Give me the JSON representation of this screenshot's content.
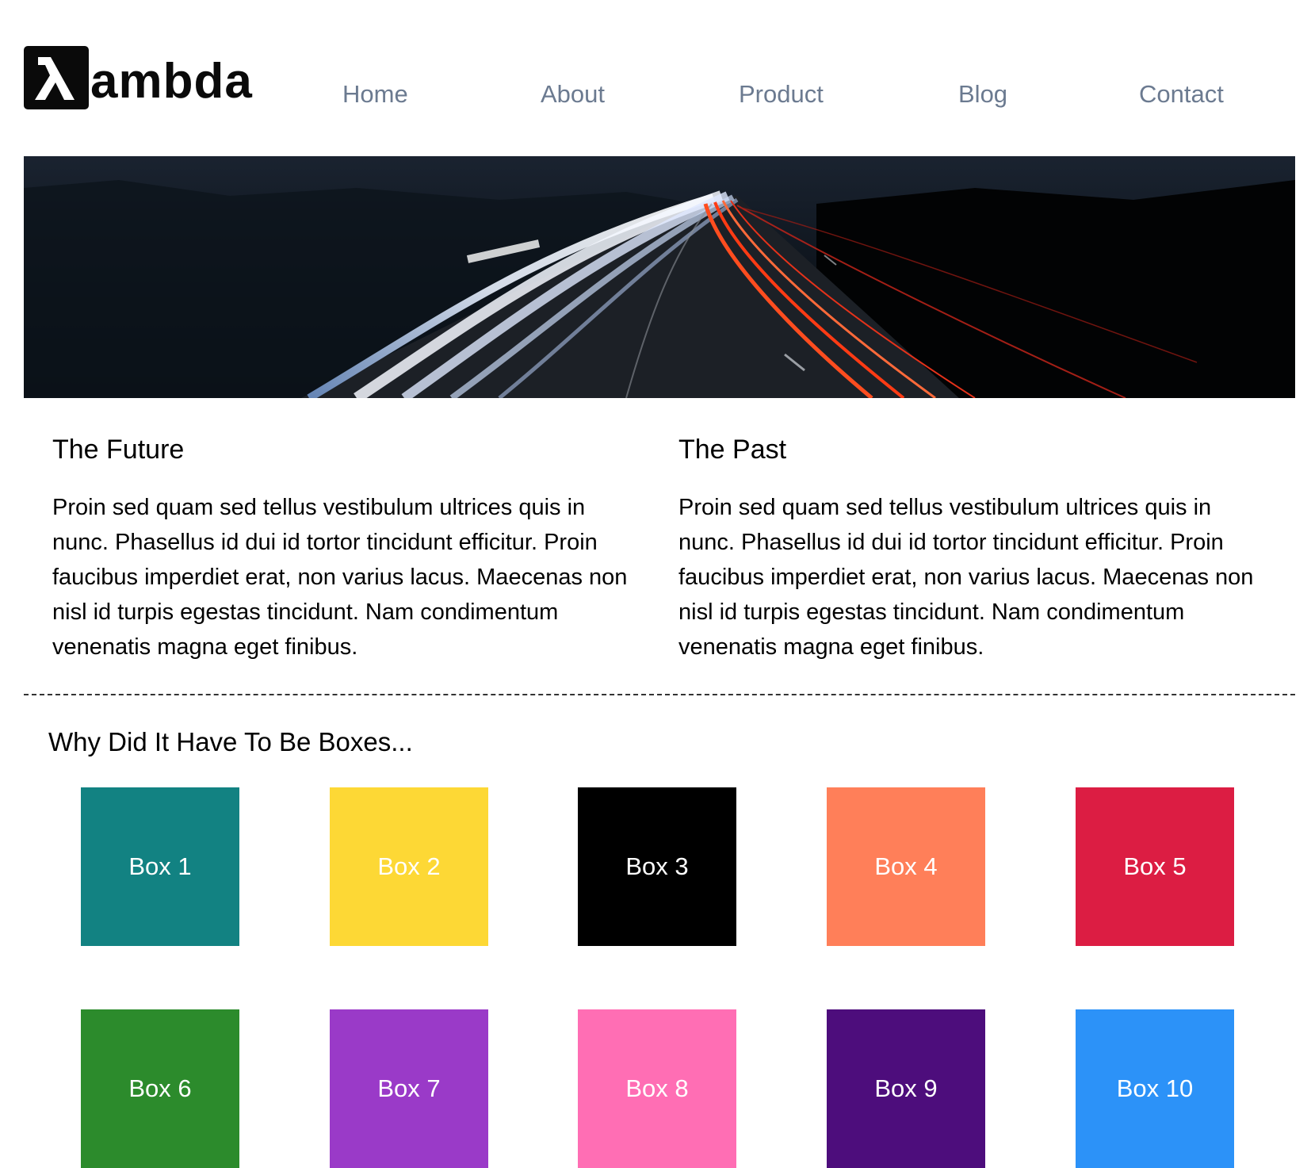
{
  "brand": {
    "logo_text": "ambda",
    "logo_symbol": "λ"
  },
  "nav": {
    "items": [
      {
        "label": "Home"
      },
      {
        "label": "About"
      },
      {
        "label": "Product"
      },
      {
        "label": "Blog"
      },
      {
        "label": "Contact"
      }
    ]
  },
  "columns": [
    {
      "heading": "The Future",
      "body": "Proin sed quam sed tellus vestibulum ultrices quis in nunc. Phasellus id dui id tortor tincidunt efficitur. Proin faucibus imperdiet erat, non varius lacus. Maecenas non nisl id turpis egestas tincidunt. Nam condimentum venenatis magna eget finibus."
    },
    {
      "heading": "The Past",
      "body": "Proin sed quam sed tellus vestibulum ultrices quis in nunc. Phasellus id dui id tortor tincidunt efficitur. Proin faucibus imperdiet erat, non varius lacus. Maecenas non nisl id turpis egestas tincidunt. Nam condimentum venenatis magna eget finibus."
    }
  ],
  "boxes_section": {
    "title": "Why Did It Have To Be Boxes...",
    "boxes": [
      {
        "label": "Box 1",
        "color": "#128282"
      },
      {
        "label": "Box 2",
        "color": "#fdd835"
      },
      {
        "label": "Box 3",
        "color": "#000000"
      },
      {
        "label": "Box 4",
        "color": "#ff7f59"
      },
      {
        "label": "Box 5",
        "color": "#dc1d43"
      },
      {
        "label": "Box 6",
        "color": "#2c8b2c"
      },
      {
        "label": "Box 7",
        "color": "#9a3ac8"
      },
      {
        "label": "Box 8",
        "color": "#ff6eb4"
      },
      {
        "label": "Box 9",
        "color": "#4d0d7c"
      },
      {
        "label": "Box 10",
        "color": "#2c92f8"
      }
    ]
  },
  "theme": {
    "nav_link_color": "#6b7a90",
    "divider_color": "#333333"
  }
}
